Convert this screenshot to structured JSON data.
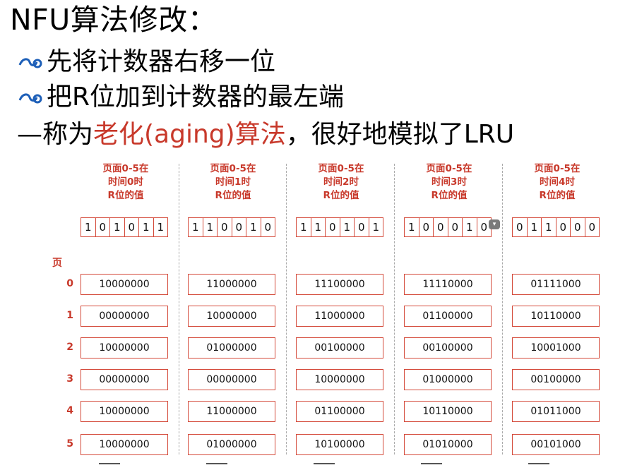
{
  "slide": {
    "title": "NFU算法修改：",
    "bullets": [
      "先将计数器右移一位",
      "把R位加到计数器的最左端"
    ],
    "line3_prefix": "—称为",
    "line3_highlight": "老化(aging)算法",
    "line3_suffix": "，很好地模拟了LRU"
  },
  "diagram": {
    "page_label": "页",
    "page_indices": [
      "0",
      "1",
      "2",
      "3",
      "4",
      "5"
    ],
    "columns": [
      {
        "hdr": [
          "页面0-5在",
          "时间0时",
          "R位的值"
        ],
        "rbits": [
          "1",
          "0",
          "1",
          "0",
          "1",
          "1"
        ],
        "counters": [
          "10000000",
          "00000000",
          "10000000",
          "00000000",
          "10000000",
          "10000000"
        ]
      },
      {
        "hdr": [
          "页面0-5在",
          "时间1时",
          "R位的值"
        ],
        "rbits": [
          "1",
          "1",
          "0",
          "0",
          "1",
          "0"
        ],
        "counters": [
          "11000000",
          "10000000",
          "01000000",
          "00000000",
          "11000000",
          "01000000"
        ]
      },
      {
        "hdr": [
          "页面0-5在",
          "时间2时",
          "R位的值"
        ],
        "rbits": [
          "1",
          "1",
          "0",
          "1",
          "0",
          "1"
        ],
        "counters": [
          "11100000",
          "11000000",
          "00100000",
          "10000000",
          "01100000",
          "10100000"
        ]
      },
      {
        "hdr": [
          "页面0-5在",
          "时间3时",
          "R位的值"
        ],
        "rbits": [
          "1",
          "0",
          "0",
          "0",
          "1",
          "0"
        ],
        "counters": [
          "11110000",
          "01100000",
          "00100000",
          "01000000",
          "10110000",
          "01010000"
        ]
      },
      {
        "hdr": [
          "页面0-5在",
          "时间4时",
          "R位的值"
        ],
        "rbits": [
          "0",
          "1",
          "1",
          "0",
          "0",
          "0"
        ],
        "counters": [
          "01111000",
          "10110000",
          "10001000",
          "00100000",
          "01011000",
          "00101000"
        ]
      }
    ]
  },
  "icons": {
    "bullet": "swirl-bullet-icon",
    "overlay": "dropdown-overlay-icon"
  },
  "colors": {
    "accent": "#c8392b",
    "border": "#d44a3a"
  }
}
